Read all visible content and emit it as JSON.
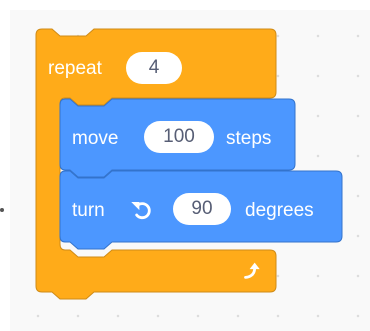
{
  "repeat_block": {
    "label": "repeat",
    "count": "4",
    "color": "#ffab19",
    "border_color": "#cf8b17",
    "loop_arrow_icon": "loop-arrow-icon"
  },
  "move_block": {
    "label": "move",
    "value": "100",
    "suffix": "steps",
    "color": "#4c97ff",
    "border_color": "#3373cc"
  },
  "turn_block": {
    "label": "turn",
    "direction_icon": "rotate-left-icon",
    "value": "90",
    "suffix": "degrees",
    "color": "#4c97ff",
    "border_color": "#3373cc"
  }
}
